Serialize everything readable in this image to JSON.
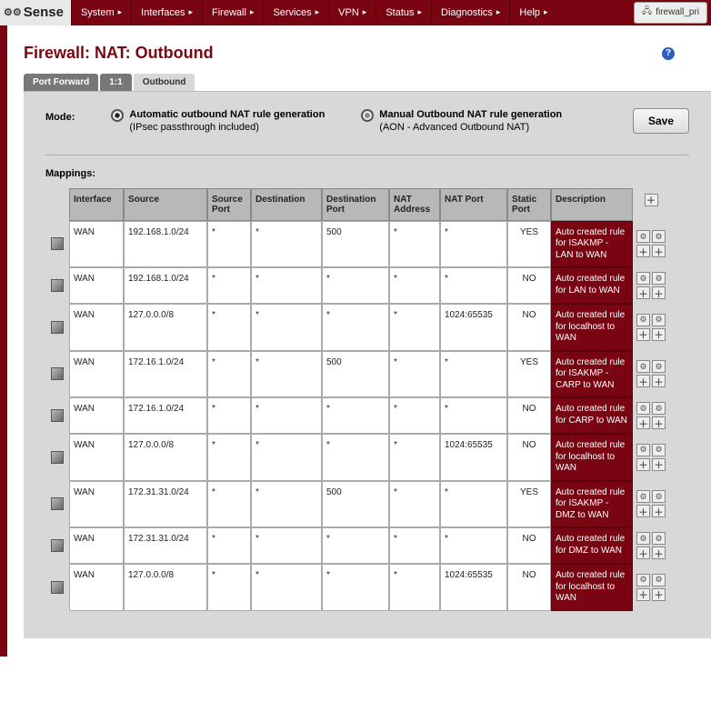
{
  "brand": "Sense",
  "menu": [
    "System",
    "Interfaces",
    "Firewall",
    "Services",
    "VPN",
    "Status",
    "Diagnostics",
    "Help"
  ],
  "right_pill": "firewall_pri",
  "page_title": "Firewall: NAT: Outbound",
  "tabs": {
    "port_forward": "Port Forward",
    "one_one": "1:1",
    "outbound": "Outbound"
  },
  "mode": {
    "label": "Mode:",
    "auto_title": "Automatic outbound NAT rule generation",
    "auto_sub": "(IPsec passthrough included)",
    "manual_title": "Manual Outbound NAT rule generation",
    "manual_sub": "(AON - Advanced Outbound NAT)",
    "save": "Save"
  },
  "mappings_label": "Mappings:",
  "columns": [
    "Interface",
    "Source",
    "Source Port",
    "Destination",
    "Destination Port",
    "NAT Address",
    "NAT Port",
    "Static Port",
    "Description"
  ],
  "rows": [
    {
      "iface": "WAN",
      "src": "192.168.1.0/24",
      "sport": "*",
      "dst": "*",
      "dport": "500",
      "naddr": "*",
      "nport": "*",
      "sp": "YES",
      "desc": "Auto created rule for ISAKMP - LAN to WAN"
    },
    {
      "iface": "WAN",
      "src": "192.168.1.0/24",
      "sport": "*",
      "dst": "*",
      "dport": "*",
      "naddr": "*",
      "nport": "*",
      "sp": "NO",
      "desc": "Auto created rule for LAN to WAN"
    },
    {
      "iface": "WAN",
      "src": "127.0.0.0/8",
      "sport": "*",
      "dst": "*",
      "dport": "*",
      "naddr": "*",
      "nport": "1024:65535",
      "sp": "NO",
      "desc": "Auto created rule for localhost to WAN"
    },
    {
      "iface": "WAN",
      "src": "172.16.1.0/24",
      "sport": "*",
      "dst": "*",
      "dport": "500",
      "naddr": "*",
      "nport": "*",
      "sp": "YES",
      "desc": "Auto created rule for ISAKMP - CARP to WAN"
    },
    {
      "iface": "WAN",
      "src": "172.16.1.0/24",
      "sport": "*",
      "dst": "*",
      "dport": "*",
      "naddr": "*",
      "nport": "*",
      "sp": "NO",
      "desc": "Auto created rule for CARP to WAN"
    },
    {
      "iface": "WAN",
      "src": "127.0.0.0/8",
      "sport": "*",
      "dst": "*",
      "dport": "*",
      "naddr": "*",
      "nport": "1024:65535",
      "sp": "NO",
      "desc": "Auto created rule for localhost to WAN"
    },
    {
      "iface": "WAN",
      "src": "172.31.31.0/24",
      "sport": "*",
      "dst": "*",
      "dport": "500",
      "naddr": "*",
      "nport": "*",
      "sp": "YES",
      "desc": "Auto created rule for ISAKMP - DMZ to WAN"
    },
    {
      "iface": "WAN",
      "src": "172.31.31.0/24",
      "sport": "*",
      "dst": "*",
      "dport": "*",
      "naddr": "*",
      "nport": "*",
      "sp": "NO",
      "desc": "Auto created rule for DMZ to WAN"
    },
    {
      "iface": "WAN",
      "src": "127.0.0.0/8",
      "sport": "*",
      "dst": "*",
      "dport": "*",
      "naddr": "*",
      "nport": "1024:65535",
      "sp": "NO",
      "desc": "Auto created rule for localhost to WAN"
    }
  ]
}
